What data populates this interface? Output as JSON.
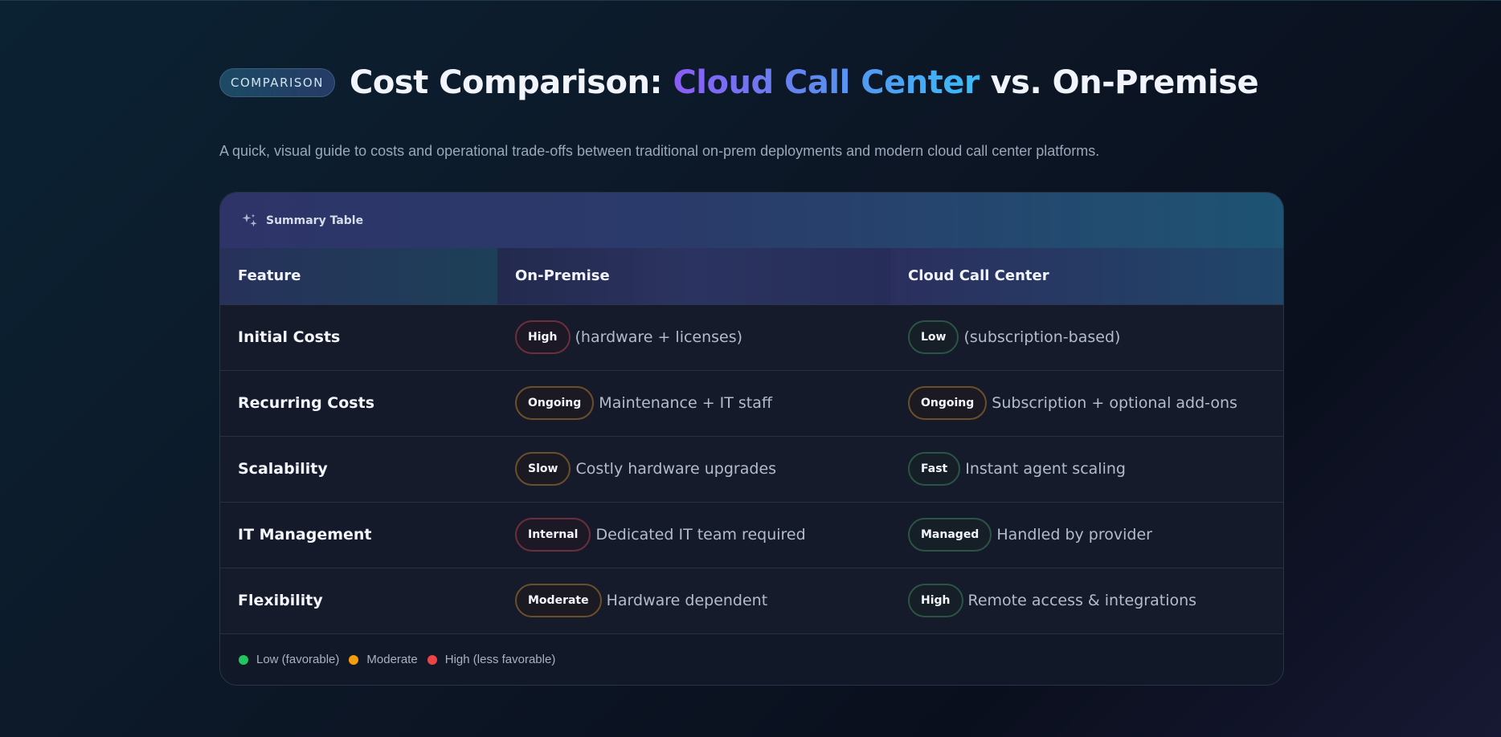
{
  "header": {
    "badge": "COMPARISON",
    "title_prefix": "Cost Comparison: ",
    "title_highlight": "Cloud Call Center",
    "title_suffix": " vs. On-Premise"
  },
  "subtitle": "A quick, visual guide to costs and operational trade-offs between traditional on-prem deployments and modern cloud call center platforms.",
  "card": {
    "title": "Summary Table",
    "icon": "sparkles-icon"
  },
  "table": {
    "columns": [
      "Feature",
      "On-Premise",
      "Cloud Call Center"
    ],
    "rows": [
      {
        "feature": "Initial Costs",
        "onprem": {
          "tag": "High",
          "level": "red",
          "text": "(hardware + licenses)"
        },
        "cloud": {
          "tag": "Low",
          "level": "green",
          "text": "(subscription-based)"
        }
      },
      {
        "feature": "Recurring Costs",
        "onprem": {
          "tag": "Ongoing",
          "level": "amber",
          "text": "Maintenance + IT staff"
        },
        "cloud": {
          "tag": "Ongoing",
          "level": "amber",
          "text": "Subscription + optional add-ons"
        }
      },
      {
        "feature": "Scalability",
        "onprem": {
          "tag": "Slow",
          "level": "amber",
          "text": "Costly hardware upgrades"
        },
        "cloud": {
          "tag": "Fast",
          "level": "green",
          "text": "Instant agent scaling"
        }
      },
      {
        "feature": "IT Management",
        "onprem": {
          "tag": "Internal",
          "level": "red",
          "text": "Dedicated IT team required"
        },
        "cloud": {
          "tag": "Managed",
          "level": "green",
          "text": "Handled by provider"
        }
      },
      {
        "feature": "Flexibility",
        "onprem": {
          "tag": "Moderate",
          "level": "amber",
          "text": "Hardware dependent"
        },
        "cloud": {
          "tag": "High",
          "level": "green",
          "text": "Remote access & integrations"
        }
      }
    ]
  },
  "legend": [
    {
      "label": "Low (favorable)",
      "color": "#22c55e"
    },
    {
      "label": "Moderate",
      "color": "#f59e0b"
    },
    {
      "label": "High (less favorable)",
      "color": "#ef4444"
    }
  ]
}
